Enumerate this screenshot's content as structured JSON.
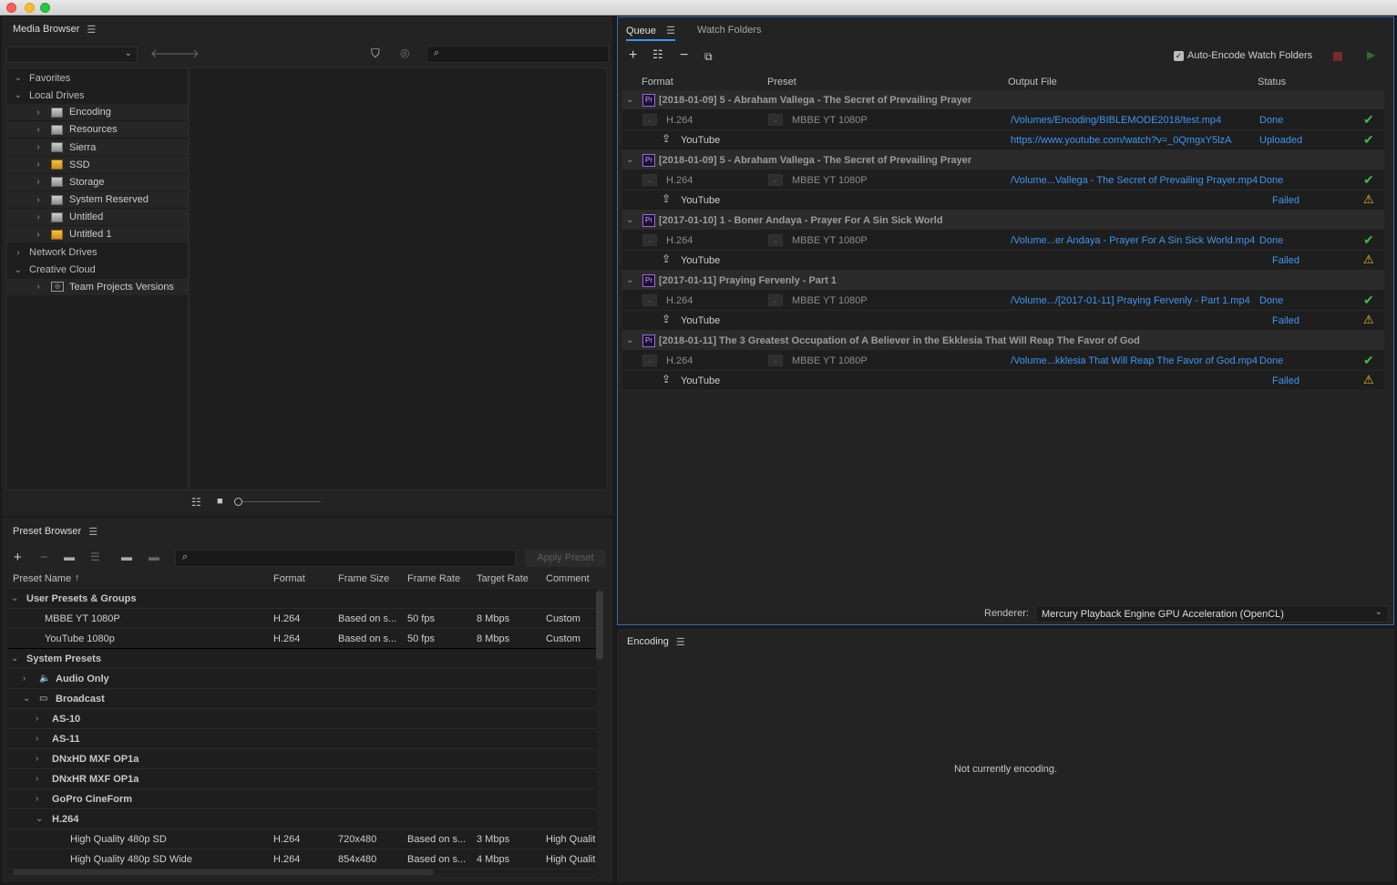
{
  "media_browser": {
    "title": "Media Browser",
    "tree": [
      {
        "label": "Favorites",
        "level": 0,
        "open": true,
        "icon": "none"
      },
      {
        "label": "Local Drives",
        "level": 0,
        "open": true,
        "icon": "none"
      },
      {
        "label": "Encoding",
        "level": 1,
        "icon": "drive"
      },
      {
        "label": "Resources",
        "level": 1,
        "icon": "drive"
      },
      {
        "label": "Sierra",
        "level": 1,
        "icon": "drive"
      },
      {
        "label": "SSD",
        "level": 1,
        "icon": "drive-yellow"
      },
      {
        "label": "Storage",
        "level": 1,
        "icon": "drive"
      },
      {
        "label": "System Reserved",
        "level": 1,
        "icon": "drive"
      },
      {
        "label": "Untitled",
        "level": 1,
        "icon": "drive"
      },
      {
        "label": "Untitled 1",
        "level": 1,
        "icon": "drive-yellow"
      },
      {
        "label": "Network Drives",
        "level": 0,
        "icon": "none"
      },
      {
        "label": "Creative Cloud",
        "level": 0,
        "open": true,
        "icon": "none"
      },
      {
        "label": "Team Projects Versions",
        "level": 1,
        "icon": "team-projects"
      }
    ]
  },
  "preset_browser": {
    "title": "Preset Browser",
    "search_placeholder": "",
    "apply_label": "Apply Preset",
    "columns": [
      "Preset Name",
      "Format",
      "Frame Size",
      "Frame Rate",
      "Target Rate",
      "Comment"
    ],
    "sort_indicator": "↑",
    "rows": [
      {
        "type": "group",
        "level": 0,
        "label": "User Presets & Groups"
      },
      {
        "type": "preset",
        "level": 1,
        "name": "MBBE YT 1080P",
        "format": "H.264",
        "size": "Based on s...",
        "rate": "50 fps",
        "target": "8 Mbps",
        "comment": "Custom"
      },
      {
        "type": "preset",
        "level": 1,
        "name": "YouTube 1080p",
        "format": "H.264",
        "size": "Based on s...",
        "rate": "50 fps",
        "target": "8 Mbps",
        "comment": "Custom"
      },
      {
        "type": "group",
        "level": 0,
        "label": "System Presets"
      },
      {
        "type": "cat",
        "level": 1,
        "label": "Audio Only",
        "icon": "speaker-icon"
      },
      {
        "type": "cat",
        "level": 1,
        "label": "Broadcast",
        "icon": "tv-icon",
        "open": true
      },
      {
        "type": "cat",
        "level": 2,
        "label": "AS-10"
      },
      {
        "type": "cat",
        "level": 2,
        "label": "AS-11"
      },
      {
        "type": "cat",
        "level": 2,
        "label": "DNxHD MXF OP1a"
      },
      {
        "type": "cat",
        "level": 2,
        "label": "DNxHR MXF OP1a"
      },
      {
        "type": "cat",
        "level": 2,
        "label": "GoPro CineForm"
      },
      {
        "type": "cat",
        "level": 2,
        "label": "H.264",
        "open": true
      },
      {
        "type": "preset",
        "level": 3,
        "name": "High Quality 480p SD",
        "format": "H.264",
        "size": "720x480",
        "rate": "Based on s...",
        "target": "3 Mbps",
        "comment": "High Qualit"
      },
      {
        "type": "preset",
        "level": 3,
        "name": "High Quality 480p SD Wide",
        "format": "H.264",
        "size": "854x480",
        "rate": "Based on s...",
        "target": "4 Mbps",
        "comment": "High Qualit"
      }
    ]
  },
  "queue": {
    "tabs": [
      "Queue",
      "Watch Folders"
    ],
    "auto_encode_label": "Auto-Encode Watch Folders",
    "columns": [
      "Format",
      "Preset",
      "Output File",
      "Status"
    ],
    "items": [
      {
        "title": "[2018-01-09] 5 - Abraham Vallega - The Secret of Prevailing Prayer",
        "format": "H.264",
        "preset": "MBBE YT 1080P",
        "output": "/Volumes/Encoding/BIBLEMODE2018/test.mp4",
        "status": "Done",
        "yt_output": "https://www.youtube.com/watch?v=_0QmgxY5lzA",
        "yt_status": "Uploaded",
        "yt_icon": "check"
      },
      {
        "title": "[2018-01-09] 5 - Abraham Vallega - The Secret of Prevailing Prayer",
        "format": "H.264",
        "preset": "MBBE YT 1080P",
        "output": "/Volume...Vallega - The Secret of Prevailing Prayer.mp4",
        "status": "Done",
        "yt_output": "",
        "yt_status": "Failed",
        "yt_icon": "warn"
      },
      {
        "title": "[2017-01-10] 1 - Boner Andaya - Prayer For A Sin Sick World",
        "format": "H.264",
        "preset": "MBBE YT 1080P",
        "output": "/Volume...er Andaya - Prayer For A Sin Sick World.mp4",
        "status": "Done",
        "yt_output": "",
        "yt_status": "Failed",
        "yt_icon": "warn"
      },
      {
        "title": "[2017-01-11] Praying Fervenly - Part 1",
        "format": "H.264",
        "preset": "MBBE YT 1080P",
        "output": "/Volume.../[2017-01-11] Praying Fervenly - Part 1.mp4",
        "status": "Done",
        "yt_output": "",
        "yt_status": "Failed",
        "yt_icon": "warn"
      },
      {
        "title": "[2018-01-11] The 3 Greatest Occupation of A Believer in the Ekklesia That Will Reap The Favor of God",
        "format": "H.264",
        "preset": "MBBE YT 1080P",
        "output": "/Volume...kklesia That Will Reap The Favor of God.mp4",
        "status": "Done",
        "yt_output": "",
        "yt_status": "Failed",
        "yt_icon": "warn"
      }
    ],
    "youtube_label": "YouTube",
    "renderer_label": "Renderer:",
    "renderer_value": "Mercury Playback Engine GPU Acceleration (OpenCL)"
  },
  "encoding": {
    "title": "Encoding",
    "status": "Not currently encoding."
  },
  "colors": {
    "accent": "#3d97f2",
    "done": "#3fbd3f",
    "warn": "#f2c227",
    "premiere": "#9a6ad6"
  }
}
